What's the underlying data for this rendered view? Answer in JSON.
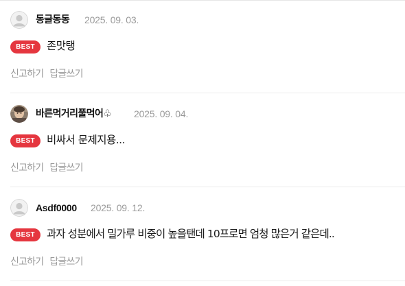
{
  "comments": [
    {
      "author": "동글동동",
      "date": "2025. 09. 03.",
      "badge": "BEST",
      "text": "존맛탱",
      "report_label": "신고하기",
      "reply_label": "답글쓰기",
      "avatar_icon": "default-user-icon"
    },
    {
      "author": "바른먹거리풀먹어♧",
      "date": "2025. 09. 04.",
      "badge": "BEST",
      "text": "비싸서 문제지용...",
      "report_label": "신고하기",
      "reply_label": "답글쓰기",
      "avatar_icon": "profile-photo"
    },
    {
      "author": "Asdf0000",
      "date": "2025. 09. 12.",
      "badge": "BEST",
      "text": "과자 성분에서 밀가루 비중이 높을탠데 10프로면 엄청 많은거 같은데..",
      "report_label": "신고하기",
      "reply_label": "답글쓰기",
      "avatar_icon": "default-user-icon"
    }
  ],
  "colors": {
    "badge_bg": "#e5363f",
    "meta_gray": "#9a9a9a",
    "author": "#111111"
  }
}
